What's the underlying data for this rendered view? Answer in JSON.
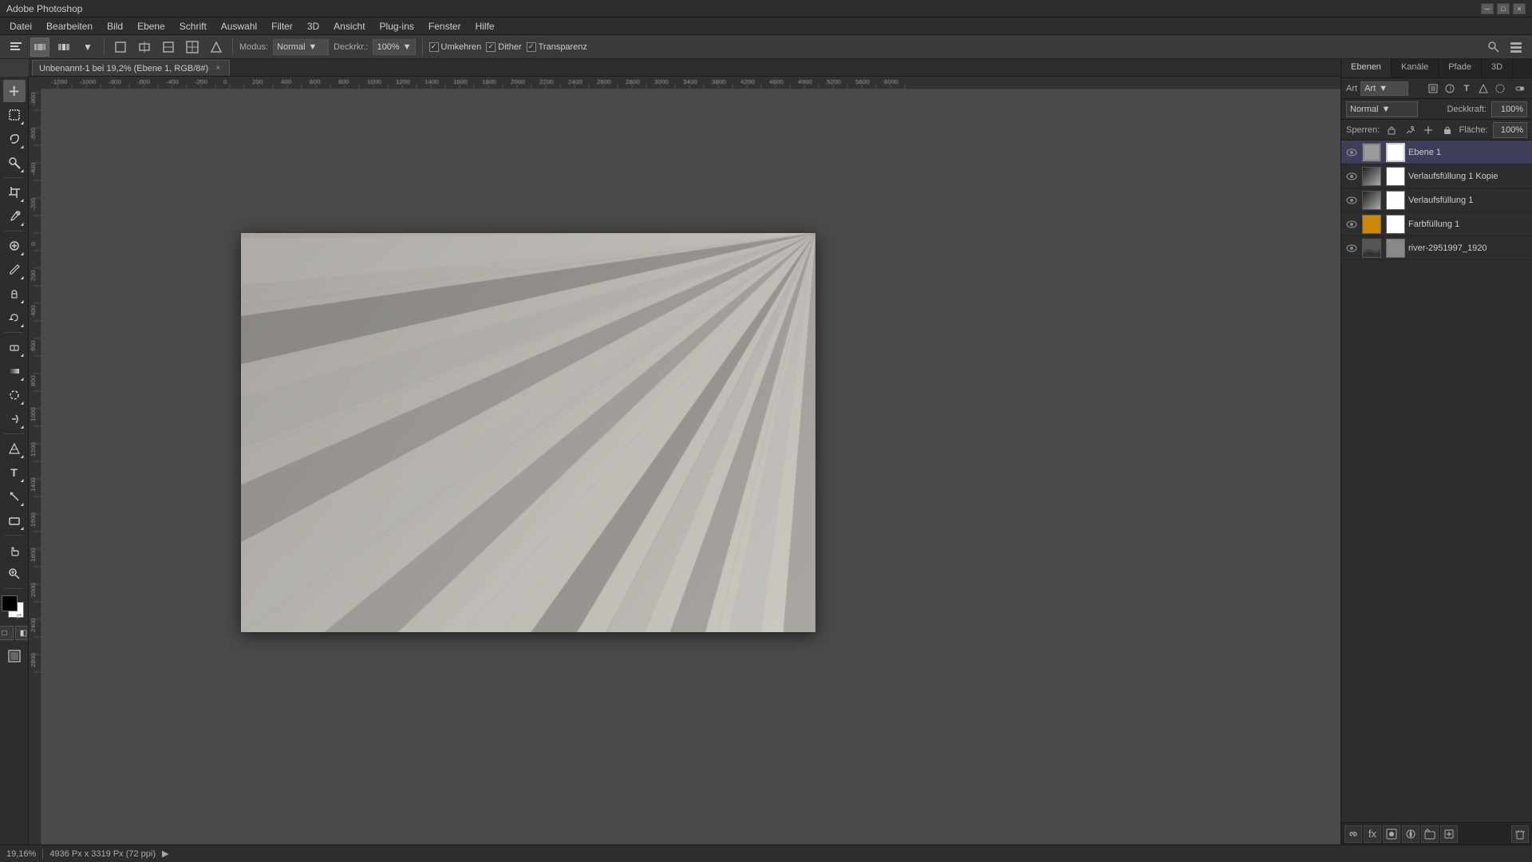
{
  "titlebar": {
    "title": "Adobe Photoshop",
    "minimize": "─",
    "maximize": "□",
    "close": "×"
  },
  "menubar": {
    "items": [
      "Datei",
      "Bearbeiten",
      "Bild",
      "Ebene",
      "Schrift",
      "Auswahl",
      "Filter",
      "3D",
      "Ansicht",
      "Plug-ins",
      "Fenster",
      "Hilfe"
    ]
  },
  "optionsbar": {
    "modus_label": "Modus:",
    "modus_value": "Normal",
    "deckraft_label": "Deckrkr.:",
    "deckraft_value": "100%",
    "umkehren_label": "Umkehren",
    "dither_label": "Dither",
    "transparenz_label": "Transparenz"
  },
  "tab": {
    "title": "Unbenannt-1 bei 19,2% (Ebene 1, RGB/8#)",
    "close": "×"
  },
  "canvas": {
    "background_color": "#4a4a4a"
  },
  "statusbar": {
    "zoom": "19,16%",
    "dimensions": "4936 Px x 3319 Px (72 ppi)",
    "arrow": "▶"
  },
  "layers": {
    "panel_title": "Ebenen",
    "channels_tab": "Kanäle",
    "paths_tab": "Pfade",
    "threed_tab": "3D",
    "filter_label": "Art",
    "blend_mode": "Normal",
    "opacity_label": "Deckkraft:",
    "opacity_value": "100%",
    "lock_label": "Sperren:",
    "fill_label": "Fläche:",
    "fill_value": "100%",
    "items": [
      {
        "id": "ebene1",
        "name": "Ebene 1",
        "visible": true,
        "selected": true,
        "type": "normal",
        "thumb_color": "#b0b0b0"
      },
      {
        "id": "verlaufsfullung1kopie",
        "name": "Verlaufsfüllung 1 Kopie",
        "visible": true,
        "selected": false,
        "type": "gradient",
        "thumb_color": "#888"
      },
      {
        "id": "verlaufsfullung1",
        "name": "Verlaufsfüllung 1",
        "visible": true,
        "selected": false,
        "type": "gradient",
        "thumb_color": "#888"
      },
      {
        "id": "farbfullung1",
        "name": "Farbfüllung 1",
        "visible": true,
        "selected": false,
        "type": "solid_color",
        "thumb_color": "#cc8800",
        "mask_color": "#fff"
      },
      {
        "id": "river",
        "name": "river-2951997_1920",
        "visible": true,
        "selected": false,
        "type": "image",
        "thumb_color": "#888"
      }
    ]
  },
  "tools": {
    "active": "move",
    "list": [
      {
        "id": "move",
        "icon": "✛",
        "label": "Verschieben-Werkzeug"
      },
      {
        "id": "selection",
        "icon": "▭",
        "label": "Auswahlwerkzeug"
      },
      {
        "id": "lasso",
        "icon": "⊙",
        "label": "Lasso"
      },
      {
        "id": "magic-wand",
        "icon": "✦",
        "label": "Zauberstab"
      },
      {
        "id": "crop",
        "icon": "⊞",
        "label": "Freistellen"
      },
      {
        "id": "eyedropper",
        "icon": "✏",
        "label": "Pipette"
      },
      {
        "id": "healing",
        "icon": "⊕",
        "label": "Reparaturpinsel"
      },
      {
        "id": "brush",
        "icon": "✒",
        "label": "Pinsel"
      },
      {
        "id": "stamp",
        "icon": "◈",
        "label": "Kopierstempel"
      },
      {
        "id": "history-brush",
        "icon": "↩",
        "label": "Protokollpinsel"
      },
      {
        "id": "eraser",
        "icon": "◻",
        "label": "Radiergummi"
      },
      {
        "id": "gradient",
        "icon": "▦",
        "label": "Verlauf"
      },
      {
        "id": "blur",
        "icon": "◎",
        "label": "Weichzeichner"
      },
      {
        "id": "dodge",
        "icon": "○",
        "label": "Abwedler"
      },
      {
        "id": "pen",
        "icon": "✒",
        "label": "Zeichenstift"
      },
      {
        "id": "type",
        "icon": "T",
        "label": "Text"
      },
      {
        "id": "path-select",
        "icon": "↖",
        "label": "Pfadauswahl"
      },
      {
        "id": "shape",
        "icon": "▬",
        "label": "Form"
      },
      {
        "id": "hand",
        "icon": "✋",
        "label": "Hand"
      },
      {
        "id": "zoom",
        "icon": "⊕",
        "label": "Zoom"
      }
    ]
  }
}
